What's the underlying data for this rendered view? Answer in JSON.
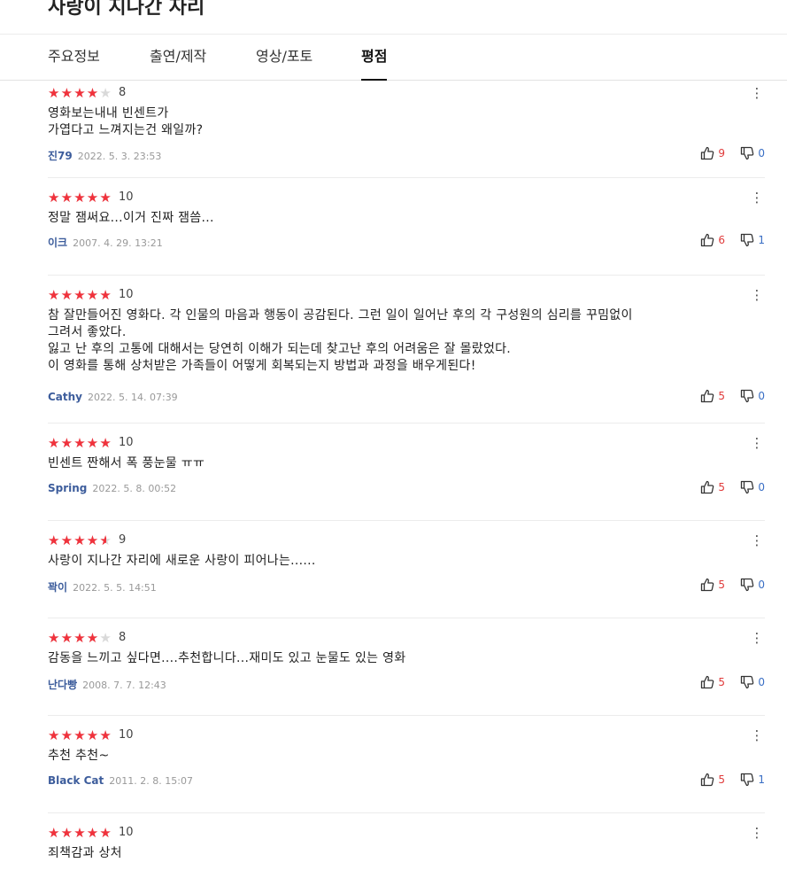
{
  "movie": {
    "title": "사랑이 지나간 자리"
  },
  "tabs": [
    {
      "label": "주요정보",
      "active": false
    },
    {
      "label": "출연/제작",
      "active": false
    },
    {
      "label": "영상/포토",
      "active": false
    },
    {
      "label": "평점",
      "active": true
    }
  ],
  "icons": {
    "star": "star-icon",
    "more": "more-vertical-icon",
    "like": "thumbs-up-icon",
    "dislike": "thumbs-down-icon"
  },
  "colors": {
    "star": "#f0323c",
    "author": "#3d5d9c",
    "like_count": "#e03b3b",
    "dislike_count": "#3a6fc5"
  },
  "reviews": [
    {
      "rating": 8,
      "text": "영화보는내내  빈센트가\n가엽다고 느껴지는건 왜일까?",
      "author": "진79",
      "date": "2022. 5. 3. 23:53",
      "likes": "9",
      "dislikes": "0"
    },
    {
      "rating": 10,
      "text": "정말 잼써요...이거 진짜 잼씀...",
      "author": "이크",
      "date": "2007. 4. 29. 13:21",
      "likes": "6",
      "dislikes": "1"
    },
    {
      "rating": 10,
      "text": "참 잘만들어진 영화다.  각 인물의 마음과 행동이 공감된다.  그런 일이 일어난 후의 각 구성원의 심리를 꾸밈없이\n그려서  좋았다.\n잃고 난 후의 고통에 대해서는  당연히 이해가 되는데 찾고난 후의 어려움은 잘 몰랐었다.\n이 영화를 통해 상처받은 가족들이 어떻게 회복되는지 방법과 과정을 배우게된다!",
      "author": "Cathy",
      "date": "2022. 5. 14. 07:39",
      "likes": "5",
      "dislikes": "0"
    },
    {
      "rating": 10,
      "text": "빈센트 짠해서 폭 풍눈물 ㅠㅠ",
      "author": "Spring",
      "date": "2022. 5. 8. 00:52",
      "likes": "5",
      "dislikes": "0"
    },
    {
      "rating": 9,
      "text": "사랑이 지나간 자리에 새로운 사랑이 피어나는......",
      "author": "꽉이",
      "date": "2022. 5. 5. 14:51",
      "likes": "5",
      "dislikes": "0"
    },
    {
      "rating": 8,
      "text": "감동을 느끼고 싶다면....추천합니다...재미도 있고 눈물도 있는 영화",
      "author": "난다빵",
      "date": "2008. 7. 7. 12:43",
      "likes": "5",
      "dislikes": "0"
    },
    {
      "rating": 10,
      "text": "추천 추천~",
      "author": "Black Cat",
      "date": "2011. 2. 8. 15:07",
      "likes": "5",
      "dislikes": "1"
    },
    {
      "rating": 10,
      "text": "죄책감과 상처",
      "author": "",
      "date": "",
      "likes": "",
      "dislikes": ""
    }
  ]
}
